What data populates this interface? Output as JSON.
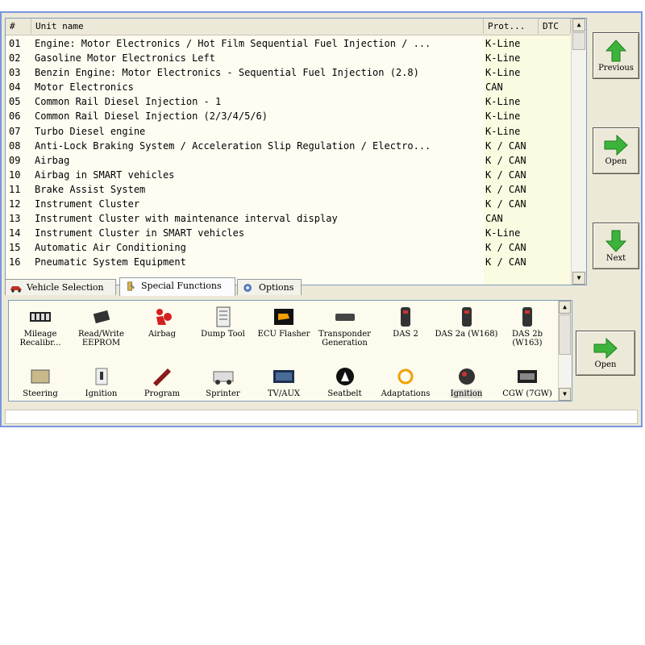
{
  "list": {
    "headers": {
      "num": "#",
      "name": "Unit name",
      "prot": "Prot...",
      "dtc": "DTC"
    },
    "rows": [
      {
        "num": "01",
        "name": "Engine: Motor Electronics / Hot Film Sequential Fuel Injection / ...",
        "prot": "K-Line",
        "dtc": ""
      },
      {
        "num": "02",
        "name": "Gasoline Motor Electronics Left",
        "prot": "K-Line",
        "dtc": ""
      },
      {
        "num": "03",
        "name": "Benzin Engine: Motor Electronics - Sequential Fuel Injection (2.8)",
        "prot": "K-Line",
        "dtc": ""
      },
      {
        "num": "04",
        "name": "Motor Electronics",
        "prot": "CAN",
        "dtc": ""
      },
      {
        "num": "05",
        "name": "Common Rail Diesel Injection - 1",
        "prot": "K-Line",
        "dtc": ""
      },
      {
        "num": "06",
        "name": "Common Rail Diesel Injection (2/3/4/5/6)",
        "prot": "K-Line",
        "dtc": ""
      },
      {
        "num": "07",
        "name": "Turbo Diesel engine",
        "prot": "K-Line",
        "dtc": ""
      },
      {
        "num": "08",
        "name": "Anti-Lock Braking System / Acceleration Slip Regulation / Electro...",
        "prot": "K / CAN",
        "dtc": ""
      },
      {
        "num": "09",
        "name": "Airbag",
        "prot": "K / CAN",
        "dtc": ""
      },
      {
        "num": "10",
        "name": "Airbag in SMART vehicles",
        "prot": "K / CAN",
        "dtc": ""
      },
      {
        "num": "11",
        "name": "Brake Assist System",
        "prot": "K / CAN",
        "dtc": ""
      },
      {
        "num": "12",
        "name": "Instrument Cluster",
        "prot": "K / CAN",
        "dtc": ""
      },
      {
        "num": "13",
        "name": "Instrument Cluster with maintenance interval display",
        "prot": "CAN",
        "dtc": ""
      },
      {
        "num": "14",
        "name": "Instrument Cluster in SMART vehicles",
        "prot": "K-Line",
        "dtc": ""
      },
      {
        "num": "15",
        "name": "Automatic Air Conditioning",
        "prot": "K / CAN",
        "dtc": ""
      },
      {
        "num": "16",
        "name": "Pneumatic System Equipment",
        "prot": "K / CAN",
        "dtc": ""
      }
    ]
  },
  "buttons": {
    "previous": "Previous",
    "open_top": "Open",
    "next": "Next",
    "open_bottom": "Open"
  },
  "tabs": [
    {
      "label": "Vehicle Selection",
      "icon": "car-icon"
    },
    {
      "label": "Special Functions",
      "icon": "wrench-icon"
    },
    {
      "label": "Options",
      "icon": "gear-icon"
    }
  ],
  "functions": [
    {
      "label": "Mileage Recalibr...",
      "icon": "odometer-icon"
    },
    {
      "label": "Read/Write EEPROM",
      "icon": "chip-icon"
    },
    {
      "label": "Airbag",
      "icon": "airbag-icon"
    },
    {
      "label": "Dump Tool",
      "icon": "dump-icon"
    },
    {
      "label": "ECU Flasher",
      "icon": "engine-light-icon"
    },
    {
      "label": "Transponder Generation",
      "icon": "transponder-icon"
    },
    {
      "label": "DAS 2",
      "icon": "key-fob-icon"
    },
    {
      "label": "DAS 2a (W168)",
      "icon": "key-fob-icon"
    },
    {
      "label": "DAS 2b (W163)",
      "icon": "key-fob-icon"
    },
    {
      "label": "Steering",
      "icon": "steering-icon"
    },
    {
      "label": "Ignition",
      "icon": "ignition-icon"
    },
    {
      "label": "Program",
      "icon": "key-icon"
    },
    {
      "label": "Sprinter",
      "icon": "van-icon"
    },
    {
      "label": "TV/AUX",
      "icon": "screen-icon"
    },
    {
      "label": "Seatbelt",
      "icon": "seatbelt-icon"
    },
    {
      "label": "Adaptations",
      "icon": "adapt-icon"
    },
    {
      "label": "Ignition",
      "icon": "ignition-switch-icon"
    },
    {
      "label": "CGW (7GW)",
      "icon": "gateway-icon"
    }
  ],
  "colors": {
    "accent_green": "#3cb43c",
    "window_border": "#7a96df",
    "panel_bg": "#ece9d8"
  }
}
